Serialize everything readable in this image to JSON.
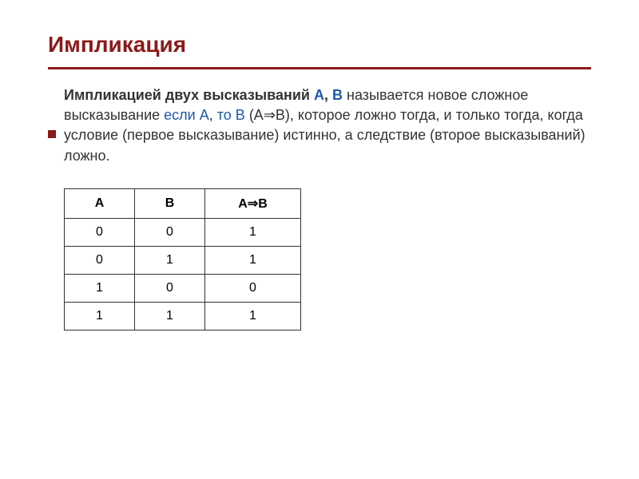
{
  "title": "Импликация",
  "definition": {
    "part1_bold": "Импликацией двух высказываний ",
    "a1": "А",
    "comma1": ", ",
    "b1": "В",
    "part2": " называется новое сложное высказывание ",
    "ifA": "если А",
    "comma2": ", ",
    "thenB": "то В",
    "part3": " (А⇒В), которое ложно тогда, и только тогда, когда условие (первое высказывание) истинно, а следствие (второе высказываний) ложно."
  },
  "table": {
    "headers": [
      "А",
      "В",
      "А⇒В"
    ],
    "rows": [
      [
        "0",
        "0",
        "1"
      ],
      [
        "0",
        "1",
        "1"
      ],
      [
        "1",
        "0",
        "0"
      ],
      [
        "1",
        "1",
        "1"
      ]
    ]
  }
}
